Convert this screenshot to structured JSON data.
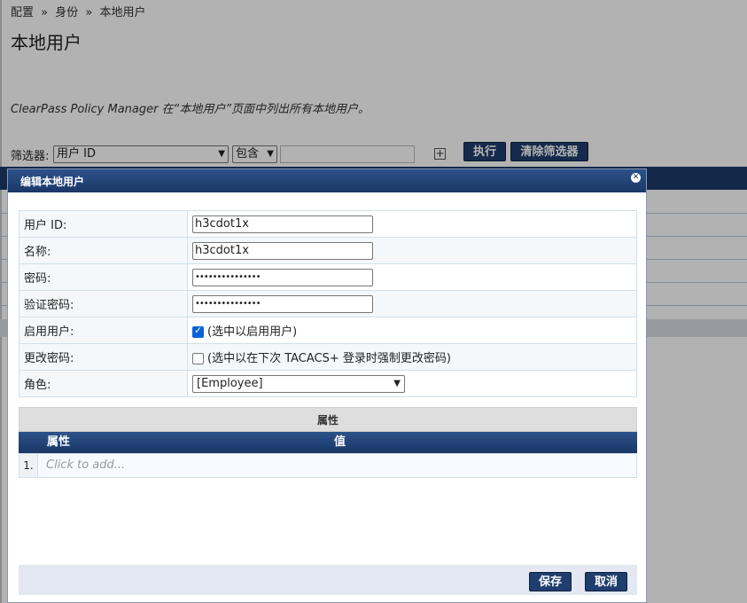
{
  "breadcrumb": [
    "配置",
    "»",
    "身份",
    "»",
    "本地用户"
  ],
  "page_title": "本地用户",
  "description": "ClearPass Policy Manager 在“本地用户”页面中列出所有本地用户。",
  "filter": {
    "label": "筛选器:",
    "field_value": "用户 ID",
    "operator_value": "包含",
    "text_value": "",
    "add_icon": "plus-icon",
    "go_label": "执行",
    "clear_label": "清除筛选器"
  },
  "dialog": {
    "title": "编辑本地用户",
    "close_icon": "close-icon",
    "fields": {
      "user_id_label": "用户 ID:",
      "user_id_value": "h3cdot1x",
      "name_label": "名称:",
      "name_value": "h3cdot1x",
      "password_label": "密码:",
      "password_value": "•••••••••••••••",
      "verify_label": "验证密码:",
      "verify_value": "•••••••••••••••",
      "enable_label": "启用用户:",
      "enable_checked": true,
      "enable_text": "(选中以启用用户)",
      "change_label": "更改密码:",
      "change_checked": false,
      "change_text": "(选中以在下次 TACACS+ 登录时强制更改密码)",
      "role_label": "角色:",
      "role_value": "[Employee]"
    },
    "attributes": {
      "section_title": "属性",
      "col_attr": "属性",
      "col_value": "值",
      "row_num": "1.",
      "placeholder": "Click to add..."
    },
    "save_label": "保存",
    "cancel_label": "取消"
  },
  "colors": {
    "header_blue": "#1a3767",
    "button_blue": "#1f3d6d",
    "checkbox_blue": "#0b62d6"
  }
}
